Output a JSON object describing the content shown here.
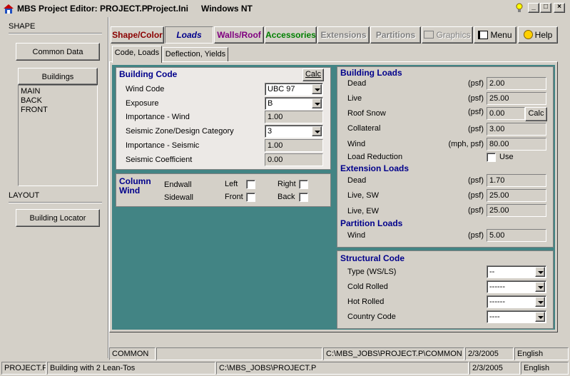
{
  "window": {
    "title": "MBS Project Editor: PROJECT.P",
    "ini": "Project.Ini",
    "os": "Windows NT"
  },
  "left": {
    "shape_label": "SHAPE",
    "common_data_label": "Common Data",
    "buildings_label": "Buildings",
    "buildings": [
      "MAIN",
      "BACK",
      "FRONT"
    ],
    "layout_label": "LAYOUT",
    "building_locator_label": "Building Locator"
  },
  "toolbar": {
    "shape_color": "Shape/Color",
    "loads": "Loads",
    "walls_roof": "Walls/Roof",
    "accessories": "Accessories",
    "extensions": "Extensions",
    "partitions": "Partitions",
    "graphics": "Graphics",
    "menu": "Menu",
    "help": "Help"
  },
  "tabs": {
    "code_loads": "Code, Loads",
    "deflection_yields": "Deflection, Yields"
  },
  "building_code": {
    "title": "Building Code",
    "calc_label": "Calc",
    "wind_code_label": "Wind Code",
    "wind_code_value": "UBC  97",
    "exposure_label": "Exposure",
    "exposure_value": "B",
    "importance_wind_label": "Importance - Wind",
    "importance_wind_value": "1.00",
    "seismic_zone_label": "Seismic Zone/Design Category",
    "seismic_zone_value": "3",
    "importance_seismic_label": "Importance - Seismic",
    "importance_seismic_value": "1.00",
    "seismic_coef_label": "Seismic Coefficient",
    "seismic_coef_value": "0.00"
  },
  "column_wind": {
    "title1": "Column",
    "title2": "Wind",
    "endwall": "Endwall",
    "sidewall": "Sidewall",
    "left": "Left",
    "right": "Right",
    "front": "Front",
    "back": "Back"
  },
  "building_loads": {
    "title": "Building Loads",
    "dead_label": "Dead",
    "dead_unit": "(psf)",
    "dead_value": "2.00",
    "live_label": "Live",
    "live_unit": "(psf)",
    "live_value": "25.00",
    "snow_label": "Roof Snow",
    "snow_unit": "(psf)",
    "snow_value": "0.00",
    "calc_label": "Calc",
    "collateral_label": "Collateral",
    "collateral_unit": "(psf)",
    "collateral_value": "3.00",
    "wind_label": "Wind",
    "wind_unit": "(mph, psf)",
    "wind_value": "80.00",
    "reduction_label": "Load Reduction",
    "use_label": "Use"
  },
  "extension_loads": {
    "title": "Extension Loads",
    "dead_label": "Dead",
    "dead_unit": "(psf)",
    "dead_value": "1.70",
    "live_sw_label": "Live, SW",
    "live_sw_unit": "(psf)",
    "live_sw_value": "25.00",
    "live_ew_label": "Live, EW",
    "live_ew_unit": "(psf)",
    "live_ew_value": "25.00"
  },
  "partition_loads": {
    "title": "Partition Loads",
    "wind_label": "Wind",
    "wind_unit": "(psf)",
    "wind_value": "5.00"
  },
  "structural_code": {
    "title": "Structural Code",
    "type_label": "Type (WS/LS)",
    "type_value": "--",
    "cold_label": "Cold Rolled",
    "cold_value": "------",
    "hot_label": "Hot Rolled",
    "hot_value": "------",
    "country_label": "Country Code",
    "country_value": "----"
  },
  "status_inner": {
    "section": "COMMON",
    "blank": "",
    "path": "C:\\MBS_JOBS\\PROJECT.P\\COMMON",
    "date": "2/3/2005",
    "lang": "English"
  },
  "status_outer": {
    "project": "PROJECT.P",
    "description": "Building with 2 Lean-Tos",
    "path": "C:\\MBS_JOBS\\PROJECT.P",
    "date": "2/3/2005",
    "lang": "English"
  },
  "colors": {
    "teal": "#428484",
    "group_title": "#00008b",
    "shape_color": "#8b0000",
    "loads": "#00008b",
    "walls_roof": "#800080",
    "accessories": "#008000"
  }
}
